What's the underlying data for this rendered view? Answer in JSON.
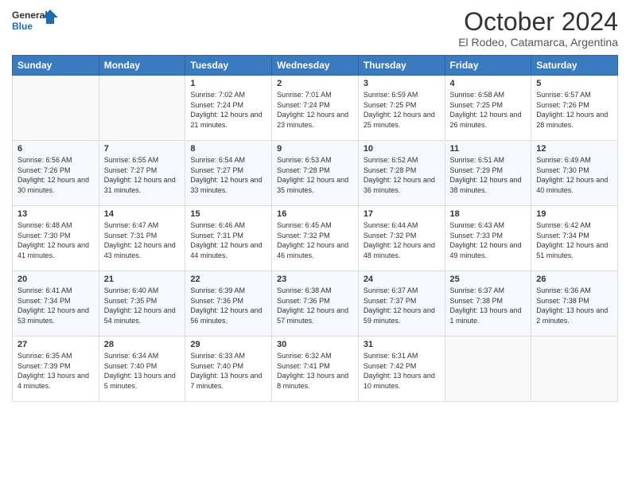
{
  "header": {
    "logo_line1": "General",
    "logo_line2": "Blue",
    "title": "October 2024",
    "location": "El Rodeo, Catamarca, Argentina"
  },
  "days_of_week": [
    "Sunday",
    "Monday",
    "Tuesday",
    "Wednesday",
    "Thursday",
    "Friday",
    "Saturday"
  ],
  "weeks": [
    [
      {
        "num": "",
        "sunrise": "",
        "sunset": "",
        "daylight": ""
      },
      {
        "num": "",
        "sunrise": "",
        "sunset": "",
        "daylight": ""
      },
      {
        "num": "1",
        "sunrise": "Sunrise: 7:02 AM",
        "sunset": "Sunset: 7:24 PM",
        "daylight": "Daylight: 12 hours and 21 minutes."
      },
      {
        "num": "2",
        "sunrise": "Sunrise: 7:01 AM",
        "sunset": "Sunset: 7:24 PM",
        "daylight": "Daylight: 12 hours and 23 minutes."
      },
      {
        "num": "3",
        "sunrise": "Sunrise: 6:59 AM",
        "sunset": "Sunset: 7:25 PM",
        "daylight": "Daylight: 12 hours and 25 minutes."
      },
      {
        "num": "4",
        "sunrise": "Sunrise: 6:58 AM",
        "sunset": "Sunset: 7:25 PM",
        "daylight": "Daylight: 12 hours and 26 minutes."
      },
      {
        "num": "5",
        "sunrise": "Sunrise: 6:57 AM",
        "sunset": "Sunset: 7:26 PM",
        "daylight": "Daylight: 12 hours and 28 minutes."
      }
    ],
    [
      {
        "num": "6",
        "sunrise": "Sunrise: 6:56 AM",
        "sunset": "Sunset: 7:26 PM",
        "daylight": "Daylight: 12 hours and 30 minutes."
      },
      {
        "num": "7",
        "sunrise": "Sunrise: 6:55 AM",
        "sunset": "Sunset: 7:27 PM",
        "daylight": "Daylight: 12 hours and 31 minutes."
      },
      {
        "num": "8",
        "sunrise": "Sunrise: 6:54 AM",
        "sunset": "Sunset: 7:27 PM",
        "daylight": "Daylight: 12 hours and 33 minutes."
      },
      {
        "num": "9",
        "sunrise": "Sunrise: 6:53 AM",
        "sunset": "Sunset: 7:28 PM",
        "daylight": "Daylight: 12 hours and 35 minutes."
      },
      {
        "num": "10",
        "sunrise": "Sunrise: 6:52 AM",
        "sunset": "Sunset: 7:28 PM",
        "daylight": "Daylight: 12 hours and 36 minutes."
      },
      {
        "num": "11",
        "sunrise": "Sunrise: 6:51 AM",
        "sunset": "Sunset: 7:29 PM",
        "daylight": "Daylight: 12 hours and 38 minutes."
      },
      {
        "num": "12",
        "sunrise": "Sunrise: 6:49 AM",
        "sunset": "Sunset: 7:30 PM",
        "daylight": "Daylight: 12 hours and 40 minutes."
      }
    ],
    [
      {
        "num": "13",
        "sunrise": "Sunrise: 6:48 AM",
        "sunset": "Sunset: 7:30 PM",
        "daylight": "Daylight: 12 hours and 41 minutes."
      },
      {
        "num": "14",
        "sunrise": "Sunrise: 6:47 AM",
        "sunset": "Sunset: 7:31 PM",
        "daylight": "Daylight: 12 hours and 43 minutes."
      },
      {
        "num": "15",
        "sunrise": "Sunrise: 6:46 AM",
        "sunset": "Sunset: 7:31 PM",
        "daylight": "Daylight: 12 hours and 44 minutes."
      },
      {
        "num": "16",
        "sunrise": "Sunrise: 6:45 AM",
        "sunset": "Sunset: 7:32 PM",
        "daylight": "Daylight: 12 hours and 46 minutes."
      },
      {
        "num": "17",
        "sunrise": "Sunrise: 6:44 AM",
        "sunset": "Sunset: 7:32 PM",
        "daylight": "Daylight: 12 hours and 48 minutes."
      },
      {
        "num": "18",
        "sunrise": "Sunrise: 6:43 AM",
        "sunset": "Sunset: 7:33 PM",
        "daylight": "Daylight: 12 hours and 49 minutes."
      },
      {
        "num": "19",
        "sunrise": "Sunrise: 6:42 AM",
        "sunset": "Sunset: 7:34 PM",
        "daylight": "Daylight: 12 hours and 51 minutes."
      }
    ],
    [
      {
        "num": "20",
        "sunrise": "Sunrise: 6:41 AM",
        "sunset": "Sunset: 7:34 PM",
        "daylight": "Daylight: 12 hours and 53 minutes."
      },
      {
        "num": "21",
        "sunrise": "Sunrise: 6:40 AM",
        "sunset": "Sunset: 7:35 PM",
        "daylight": "Daylight: 12 hours and 54 minutes."
      },
      {
        "num": "22",
        "sunrise": "Sunrise: 6:39 AM",
        "sunset": "Sunset: 7:36 PM",
        "daylight": "Daylight: 12 hours and 56 minutes."
      },
      {
        "num": "23",
        "sunrise": "Sunrise: 6:38 AM",
        "sunset": "Sunset: 7:36 PM",
        "daylight": "Daylight: 12 hours and 57 minutes."
      },
      {
        "num": "24",
        "sunrise": "Sunrise: 6:37 AM",
        "sunset": "Sunset: 7:37 PM",
        "daylight": "Daylight: 12 hours and 59 minutes."
      },
      {
        "num": "25",
        "sunrise": "Sunrise: 6:37 AM",
        "sunset": "Sunset: 7:38 PM",
        "daylight": "Daylight: 13 hours and 1 minute."
      },
      {
        "num": "26",
        "sunrise": "Sunrise: 6:36 AM",
        "sunset": "Sunset: 7:38 PM",
        "daylight": "Daylight: 13 hours and 2 minutes."
      }
    ],
    [
      {
        "num": "27",
        "sunrise": "Sunrise: 6:35 AM",
        "sunset": "Sunset: 7:39 PM",
        "daylight": "Daylight: 13 hours and 4 minutes."
      },
      {
        "num": "28",
        "sunrise": "Sunrise: 6:34 AM",
        "sunset": "Sunset: 7:40 PM",
        "daylight": "Daylight: 13 hours and 5 minutes."
      },
      {
        "num": "29",
        "sunrise": "Sunrise: 6:33 AM",
        "sunset": "Sunset: 7:40 PM",
        "daylight": "Daylight: 13 hours and 7 minutes."
      },
      {
        "num": "30",
        "sunrise": "Sunrise: 6:32 AM",
        "sunset": "Sunset: 7:41 PM",
        "daylight": "Daylight: 13 hours and 8 minutes."
      },
      {
        "num": "31",
        "sunrise": "Sunrise: 6:31 AM",
        "sunset": "Sunset: 7:42 PM",
        "daylight": "Daylight: 13 hours and 10 minutes."
      },
      {
        "num": "",
        "sunrise": "",
        "sunset": "",
        "daylight": ""
      },
      {
        "num": "",
        "sunrise": "",
        "sunset": "",
        "daylight": ""
      }
    ]
  ]
}
